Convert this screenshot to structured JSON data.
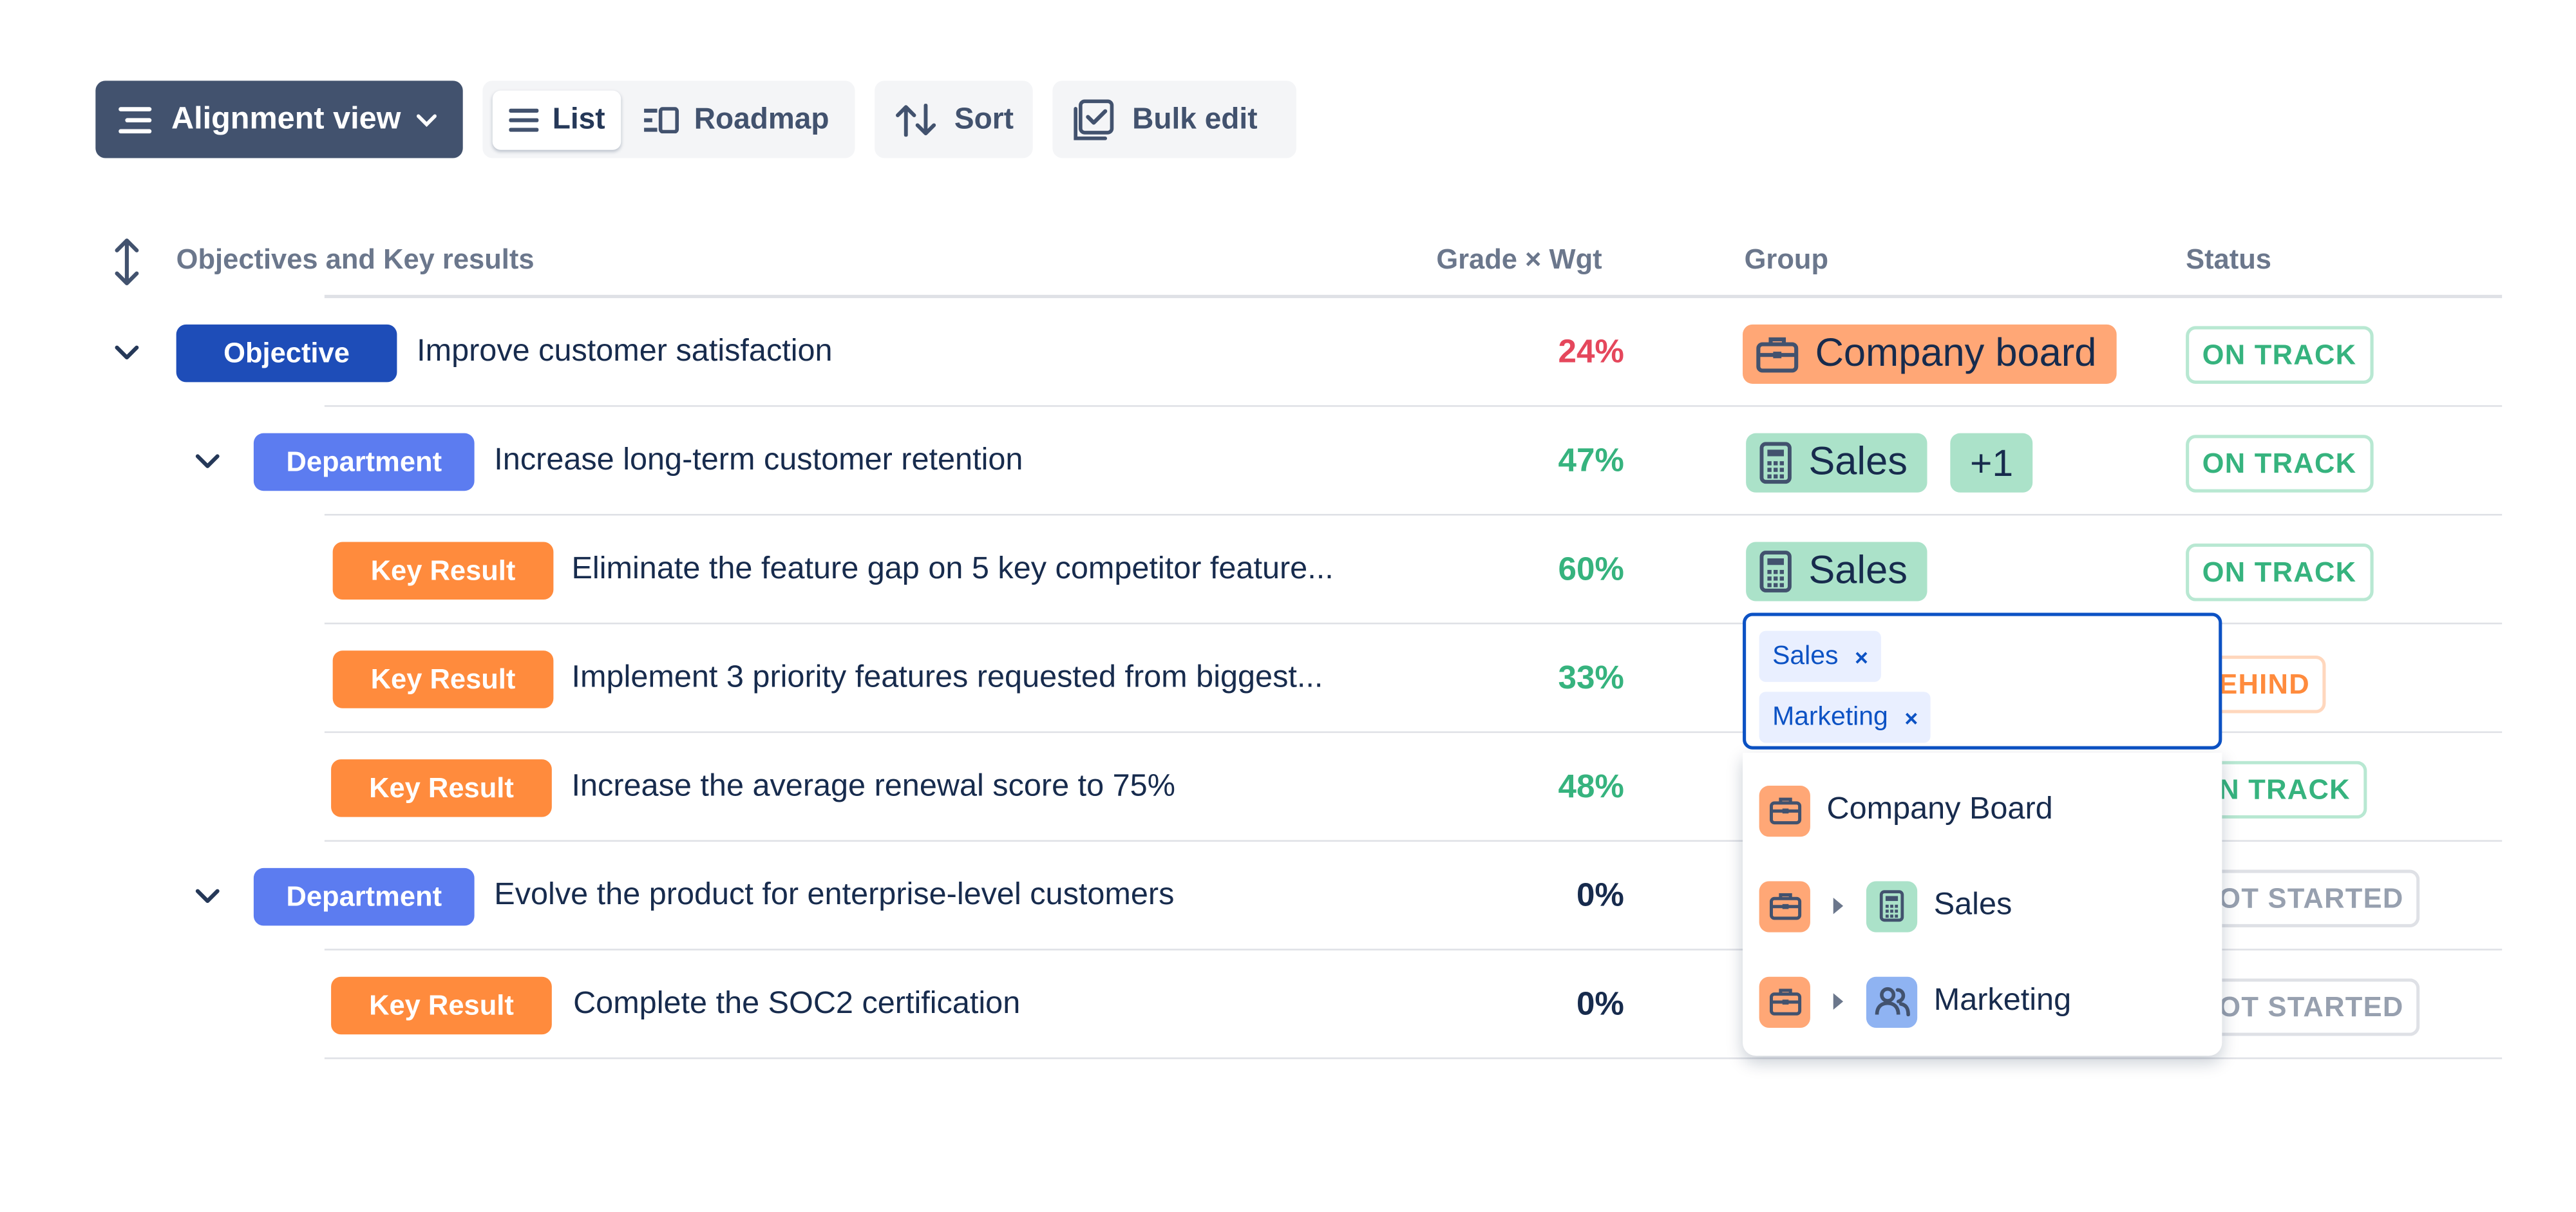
{
  "toolbar": {
    "view_label": "Alignment view",
    "list_label": "List",
    "roadmap_label": "Roadmap",
    "sort_label": "Sort",
    "bulk_edit_label": "Bulk edit"
  },
  "table": {
    "col_okr": "Objectives and Key results",
    "col_grade": "Grade × Wgt",
    "col_group": "Group",
    "col_status": "Status"
  },
  "rows": [
    {
      "type": "Objective",
      "title": "Improve customer satisfaction",
      "grade": "24%",
      "group": "Company board",
      "group_icon": "briefcase-icon",
      "status": "ON TRACK"
    },
    {
      "type": "Department",
      "title": "Increase long-term customer retention",
      "grade": "47%",
      "group": "Sales",
      "group_icon": "calculator-icon",
      "group_extra": "+1",
      "status": "ON TRACK"
    },
    {
      "type": "Key Result",
      "title": "Eliminate the feature gap on 5 key competitor feature...",
      "grade": "60%",
      "group": "Sales",
      "group_icon": "calculator-icon",
      "status": "ON TRACK"
    },
    {
      "type": "Key Result",
      "title": "Implement 3 priority features requested from biggest...",
      "grade": "33%",
      "status": "EHIND"
    },
    {
      "type": "Key Result",
      "title": "Increase the average renewal score to 75%",
      "grade": "48%",
      "status": "N TRACK"
    },
    {
      "type": "Department",
      "title": "Evolve the product for enterprise-level customers",
      "grade": "0%",
      "status": "OT STARTED"
    },
    {
      "type": "Key Result",
      "title": "Complete the SOC2 certification",
      "grade": "0%",
      "status": "OT STARTED"
    }
  ],
  "group_picker": {
    "selected": [
      "Sales",
      "Marketing"
    ],
    "remove_glyph": "×",
    "options": [
      {
        "label": "Company Board",
        "icon": "briefcase-icon"
      },
      {
        "label": "Sales",
        "icon": "calculator-icon"
      },
      {
        "label": "Marketing",
        "icon": "people-icon"
      }
    ]
  },
  "colors": {
    "toolbar_primary": "#42526e",
    "objective": "#1e4db8",
    "department": "#5c7cf0",
    "key_result": "#ff8b3d",
    "grade_red": "#e5475c",
    "grade_green": "#36b37e",
    "company_board_chip": "#ffa776",
    "sales_chip": "#abe2c9",
    "marketing_icon": "#8fb3f2",
    "picker_border": "#0c52c4"
  }
}
